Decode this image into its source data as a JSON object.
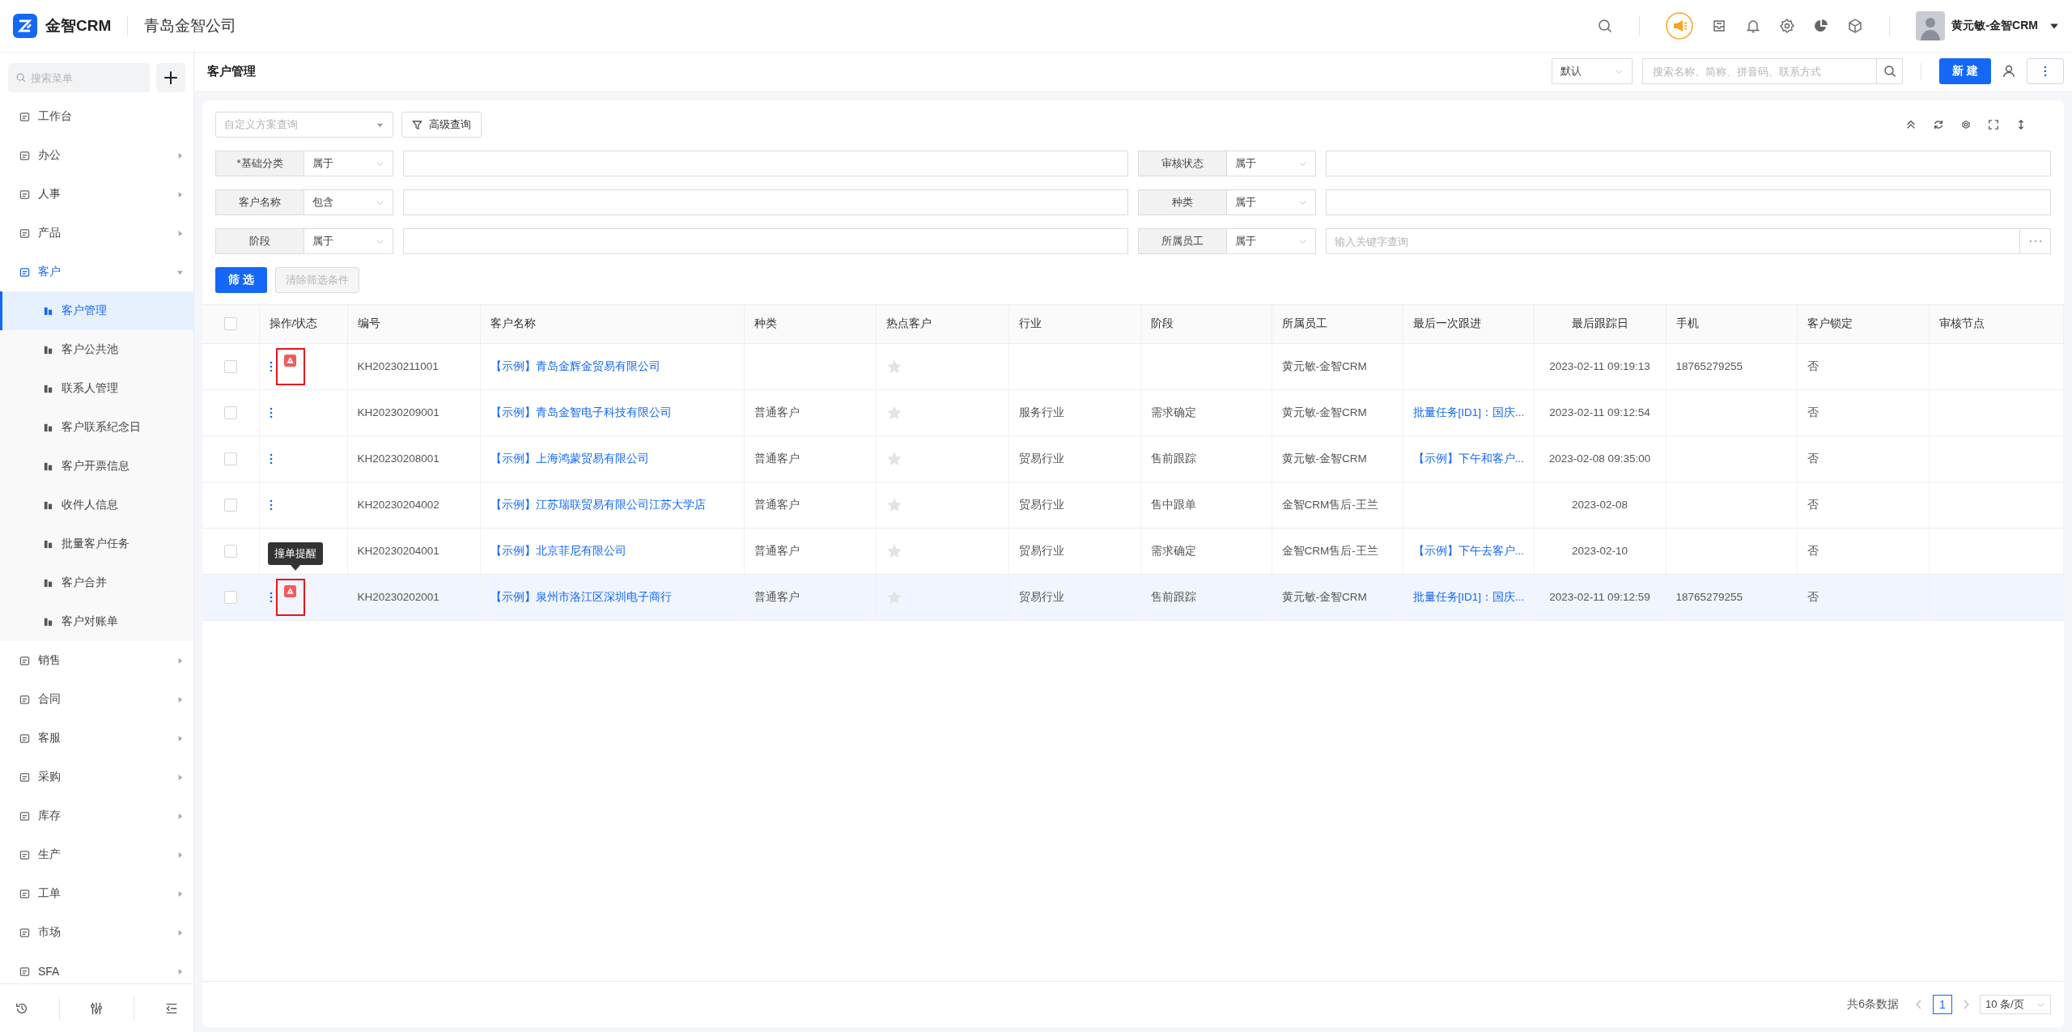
{
  "app": {
    "logo_text": "金智CRM",
    "company": "青岛金智公司"
  },
  "user": {
    "name": "黄元敏-金智CRM"
  },
  "sidebar": {
    "search_placeholder": "搜索菜单",
    "items": [
      {
        "label": "工作台",
        "active": false
      },
      {
        "label": "办公",
        "expandable": true,
        "expanded": false,
        "active": false
      },
      {
        "label": "人事",
        "expandable": true,
        "expanded": false,
        "active": false
      },
      {
        "label": "产品",
        "expandable": true,
        "expanded": false,
        "active": false
      },
      {
        "label": "客户",
        "expandable": true,
        "expanded": true,
        "active": true,
        "children": [
          {
            "label": "客户管理",
            "selected": true
          },
          {
            "label": "客户公共池",
            "selected": false
          },
          {
            "label": "联系人管理",
            "selected": false
          },
          {
            "label": "客户联系纪念日",
            "selected": false
          },
          {
            "label": "客户开票信息",
            "selected": false
          },
          {
            "label": "收件人信息",
            "selected": false
          },
          {
            "label": "批量客户任务",
            "selected": false
          },
          {
            "label": "客户合并",
            "selected": false
          },
          {
            "label": "客户对账单",
            "selected": false
          }
        ]
      },
      {
        "label": "销售",
        "expandable": true,
        "expanded": false,
        "active": false
      },
      {
        "label": "合同",
        "expandable": true,
        "expanded": false,
        "active": false
      },
      {
        "label": "客服",
        "expandable": true,
        "expanded": false,
        "active": false
      },
      {
        "label": "采购",
        "expandable": true,
        "expanded": false,
        "active": false
      },
      {
        "label": "库存",
        "expandable": true,
        "expanded": false,
        "active": false
      },
      {
        "label": "生产",
        "expandable": true,
        "expanded": false,
        "active": false
      },
      {
        "label": "工单",
        "expandable": true,
        "expanded": false,
        "active": false
      },
      {
        "label": "市场",
        "expandable": true,
        "expanded": false,
        "active": false
      },
      {
        "label": "SFA",
        "expandable": true,
        "expanded": false,
        "active": false
      }
    ]
  },
  "page": {
    "title": "客户管理",
    "view_select": "默认",
    "search_placeholder": "搜索名称、简称、拼音码、联系方式",
    "new_button": "新 建"
  },
  "filter": {
    "scheme_placeholder": "自定义方案查询",
    "advanced_button": "高级查询",
    "fields": [
      {
        "label": "*基础分类",
        "operator": "属于",
        "kind": "text"
      },
      {
        "label": "审核状态",
        "operator": "属于",
        "kind": "text"
      },
      {
        "label": "客户名称",
        "operator": "包含",
        "kind": "text"
      },
      {
        "label": "种类",
        "operator": "属于",
        "kind": "text"
      },
      {
        "label": "阶段",
        "operator": "属于",
        "kind": "text"
      },
      {
        "label": "所属员工",
        "operator": "属于",
        "kind": "picker",
        "placeholder": "输入关键字查询"
      }
    ],
    "apply_button": "筛 选",
    "clear_button": {
      "label": "清除筛选条件",
      "disabled": true
    }
  },
  "table": {
    "select_all_checked": false,
    "columns": [
      "操作/状态",
      "编号",
      "客户名称",
      "种类",
      "热点客户",
      "行业",
      "阶段",
      "所属员工",
      "最后一次跟进",
      "最后跟踪日",
      "手机",
      "客户锁定",
      "审核节点"
    ],
    "rows": [
      {
        "checked": false,
        "warning": true,
        "marked": true,
        "hovered": false,
        "code": "KH20230211001",
        "name": "【示例】青岛金辉金贸易有限公司",
        "hot": false,
        "owner": "黄元敏-金智CRM",
        "last_date": "2023-02-11 09:19:13",
        "phone": "18765279255",
        "locked": "否"
      },
      {
        "checked": false,
        "warning": false,
        "marked": false,
        "hovered": false,
        "code": "KH20230209001",
        "name": "【示例】青岛金智电子科技有限公司",
        "type": "普通客户",
        "hot": false,
        "industry": "服务行业",
        "stage": "需求确定",
        "owner": "黄元敏-金智CRM",
        "last_followup": "批量任务[ID1]：国庆...",
        "last_date": "2023-02-11 09:12:54",
        "locked": "否"
      },
      {
        "checked": false,
        "warning": false,
        "marked": false,
        "hovered": false,
        "code": "KH20230208001",
        "name": "【示例】上海鸿蒙贸易有限公司",
        "type": "普通客户",
        "hot": false,
        "industry": "贸易行业",
        "stage": "售前跟踪",
        "owner": "黄元敏-金智CRM",
        "last_followup": "【示例】下午和客户...",
        "last_date": "2023-02-08 09:35:00",
        "locked": "否"
      },
      {
        "checked": false,
        "warning": false,
        "marked": false,
        "hovered": false,
        "code": "KH20230204002",
        "name": "【示例】江苏瑞联贸易有限公司江苏大学店",
        "type": "普通客户",
        "hot": false,
        "industry": "贸易行业",
        "stage": "售中跟单",
        "owner": "金智CRM售后-王兰",
        "last_date": "2023-02-08",
        "locked": "否"
      },
      {
        "checked": false,
        "warning": false,
        "marked": false,
        "hovered": false,
        "code": "KH20230204001",
        "name": "【示例】北京菲尼有限公司",
        "type": "普通客户",
        "hot": false,
        "industry": "贸易行业",
        "stage": "需求确定",
        "owner": "金智CRM售后-王兰",
        "last_followup": "【示例】下午去客户...",
        "last_date": "2023-02-10",
        "locked": "否"
      },
      {
        "checked": false,
        "warning": true,
        "marked": true,
        "hovered": true,
        "tooltip": "撞单提醒",
        "code": "KH20230202001",
        "name": "【示例】泉州市洛江区深圳电子商行",
        "type": "普通客户",
        "hot": false,
        "industry": "贸易行业",
        "stage": "售前跟踪",
        "owner": "黄元敏-金智CRM",
        "last_followup": "批量任务[ID1]：国庆...",
        "last_date": "2023-02-11 09:12:59",
        "phone": "18765279255",
        "locked": "否"
      }
    ]
  },
  "pagination": {
    "total": "共6条数据",
    "pages": [
      {
        "label": "1",
        "selected": true
      }
    ],
    "page_size": "10 条/页"
  }
}
